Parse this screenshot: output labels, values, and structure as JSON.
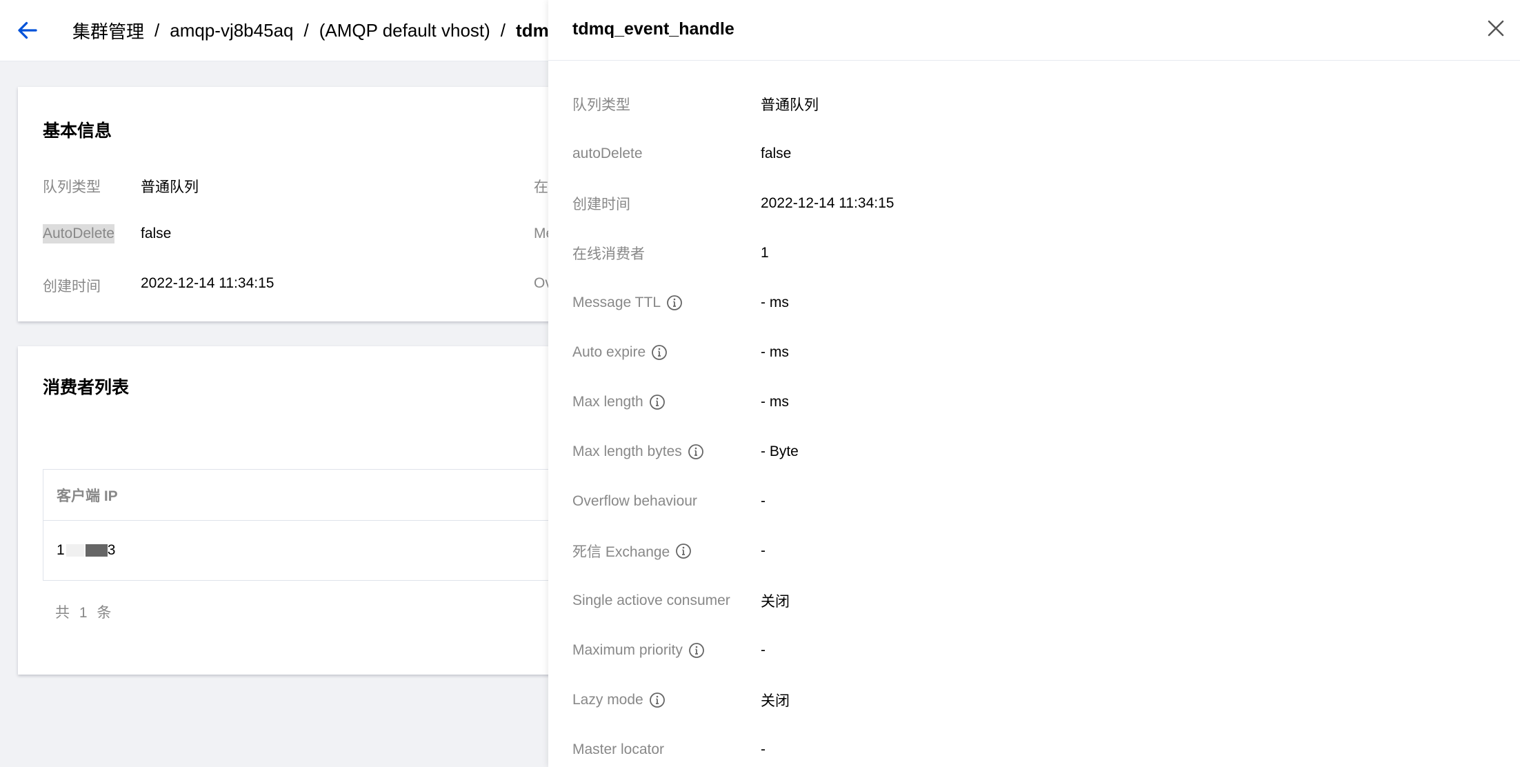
{
  "header": {
    "breadcrumb": [
      "集群管理",
      "amqp-vj8b45aq",
      "(AMQP default vhost)",
      "tdmq"
    ],
    "separator": "/"
  },
  "basic_info": {
    "title": "基本信息",
    "rows": [
      {
        "label": "队列类型",
        "value": "普通队列"
      },
      {
        "label": "AutoDelete",
        "value": "false"
      },
      {
        "label": "创建时间",
        "value": "2022-12-14 11:34:15"
      }
    ],
    "right_col_labels": [
      "在",
      "Me",
      "Ov"
    ]
  },
  "consumers": {
    "title": "消费者列表",
    "column_header": "客户端 IP",
    "row_ip_start": "1",
    "row_ip_end": "3",
    "total": "共 1 条"
  },
  "drawer": {
    "title": "tdmq_event_handle",
    "rows": [
      {
        "label": "队列类型",
        "value": "普通队列",
        "info": false
      },
      {
        "label": "autoDelete",
        "value": "false",
        "info": false
      },
      {
        "label": "创建时间",
        "value": "2022-12-14 11:34:15",
        "info": false
      },
      {
        "label": "在线消费者",
        "value": "1",
        "info": false
      },
      {
        "label": "Message TTL",
        "value": "- ms",
        "info": true
      },
      {
        "label": "Auto expire",
        "value": "- ms",
        "info": true
      },
      {
        "label": "Max length",
        "value": "- ms",
        "info": true
      },
      {
        "label": "Max length bytes",
        "value": "- Byte",
        "info": true
      },
      {
        "label": "Overflow behaviour",
        "value": "-",
        "info": false
      },
      {
        "label": "死信 Exchange",
        "value": "-",
        "info": true
      },
      {
        "label": "Single actiove consumer",
        "value": "关闭",
        "info": false
      },
      {
        "label": "Maximum priority",
        "value": "-",
        "info": true
      },
      {
        "label": "Lazy mode",
        "value": "关闭",
        "info": true
      },
      {
        "label": "Master locator",
        "value": "-",
        "info": false
      }
    ]
  },
  "colors": {
    "accent": "#0052d9",
    "muted": "#888888",
    "background": "#f1f2f5"
  }
}
